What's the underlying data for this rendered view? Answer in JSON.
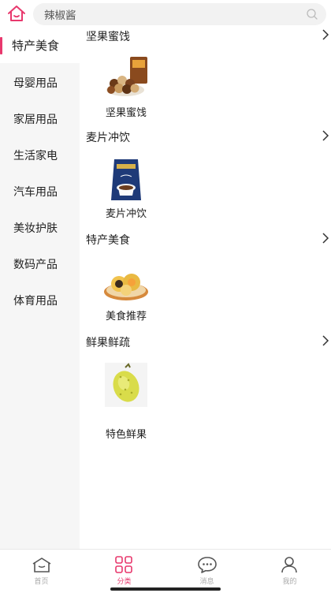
{
  "header": {
    "home_icon": "home-icon",
    "search": {
      "value": "辣椒酱",
      "icon": "search-icon"
    }
  },
  "sidebar": {
    "items": [
      {
        "label": "特产美食",
        "active": true
      },
      {
        "label": "母婴用品",
        "active": false
      },
      {
        "label": "家居用品",
        "active": false
      },
      {
        "label": "生活家电",
        "active": false
      },
      {
        "label": "汽车用品",
        "active": false
      },
      {
        "label": "美妆护肤",
        "active": false
      },
      {
        "label": "数码产品",
        "active": false
      },
      {
        "label": "体育用品",
        "active": false
      }
    ],
    "accent_color": "#e8386d"
  },
  "sections": [
    {
      "title": "坚果蜜饯",
      "items": [
        {
          "label": "坚果蜜饯",
          "image": "macadamia-nuts-image"
        }
      ]
    },
    {
      "title": "麦片冲饮",
      "items": [
        {
          "label": "麦片冲饮",
          "image": "coffee-package-image"
        }
      ]
    },
    {
      "title": "特产美食",
      "items": [
        {
          "label": "美食推荐",
          "image": "pastry-plate-image"
        }
      ]
    },
    {
      "title": "鲜果鲜疏",
      "items": [
        {
          "label": "特色鲜果",
          "image": "durian-image"
        }
      ]
    }
  ],
  "tabbar": {
    "tabs": [
      {
        "label": "首页",
        "icon": "home-tab-icon",
        "active": false
      },
      {
        "label": "分类",
        "icon": "category-grid-icon",
        "active": true
      },
      {
        "label": "消息",
        "icon": "chat-bubble-icon",
        "active": false
      },
      {
        "label": "我的",
        "icon": "person-icon",
        "active": false
      }
    ]
  }
}
